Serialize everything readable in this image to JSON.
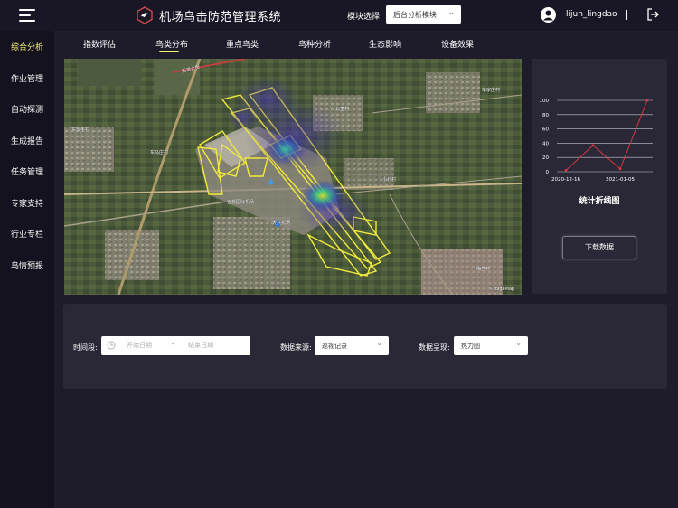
{
  "header": {
    "app_title": "机场鸟击防范管理系统",
    "module_label": "模块选择:",
    "module_value": "后台分析模块",
    "username": "lijun_lingdao"
  },
  "sidebar": {
    "items": [
      {
        "label": "综合分析",
        "active": true
      },
      {
        "label": "作业管理",
        "active": false
      },
      {
        "label": "自动探测",
        "active": false
      },
      {
        "label": "生成报告",
        "active": false
      },
      {
        "label": "任务管理",
        "active": false
      },
      {
        "label": "专家支持",
        "active": false
      },
      {
        "label": "行业专栏",
        "active": false
      },
      {
        "label": "鸟情预报",
        "active": false
      }
    ]
  },
  "tabs": [
    {
      "label": "指数评估",
      "active": false
    },
    {
      "label": "鸟类分布",
      "active": true
    },
    {
      "label": "重点鸟类",
      "active": false
    },
    {
      "label": "鸟种分析",
      "active": false
    },
    {
      "label": "生态影响",
      "active": false
    },
    {
      "label": "设备效果",
      "active": false
    }
  ],
  "map": {
    "labels": [
      "东安丰村",
      "车家庄村",
      "东马庄村",
      "北皇村",
      "小北村",
      "梅兰村",
      "首都国际机场",
      "新源大街",
      "大兴机场"
    ],
    "attribution": "© BigeMap"
  },
  "chart_data": {
    "type": "line",
    "title": "统计折线图",
    "xlabel": "",
    "ylabel": "",
    "x_tick_labels": [
      "2020-12-16",
      "2021-01-05"
    ],
    "y_ticks": [
      0,
      20,
      40,
      60,
      80,
      100
    ],
    "ylim": [
      0,
      100
    ],
    "grid": true,
    "series": [
      {
        "values": [
          2,
          37,
          4,
          100
        ],
        "color": "#e03a3a"
      }
    ]
  },
  "actions": {
    "download": "下载数据"
  },
  "filters": {
    "time_label": "时间段:",
    "start_placeholder": "开始日期",
    "separator": "-",
    "end_placeholder": "结束日期",
    "source_label": "数据来源:",
    "source_value": "巡视记录",
    "display_label": "数据呈现:",
    "display_value": "热力图"
  }
}
